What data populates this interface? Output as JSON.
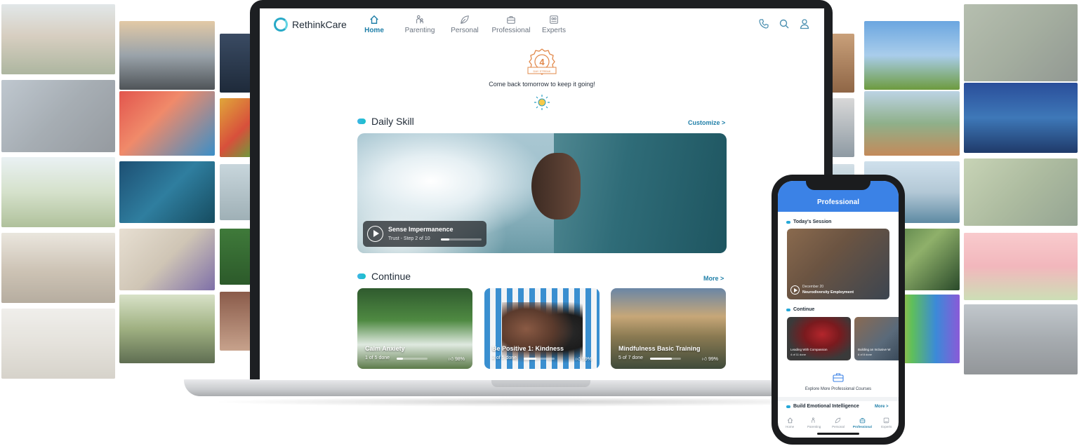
{
  "app": {
    "logo_text": "RethinkCare",
    "accent": "#1f7fa8",
    "phone_header_color": "#3b82e6"
  },
  "nav": {
    "items": [
      {
        "label": "Home",
        "icon": "home-icon",
        "active": true
      },
      {
        "label": "Parenting",
        "icon": "parenting-icon",
        "active": false
      },
      {
        "label": "Personal",
        "icon": "leaf-icon",
        "active": false
      },
      {
        "label": "Professional",
        "icon": "briefcase-icon",
        "active": false
      },
      {
        "label": "Experts",
        "icon": "experts-icon",
        "active": false
      }
    ],
    "right_icons": [
      "phone-icon",
      "search-icon",
      "user-icon"
    ]
  },
  "streak": {
    "count": "4",
    "badge_caption": "DAY STREAK",
    "message": "Come back tomorrow to keep it going!"
  },
  "daily_skill": {
    "heading": "Daily Skill",
    "link": "Customize >",
    "card_title": "Sense Impermanence",
    "card_sub": "Trust - Step 2 of 10",
    "progress": 0.2
  },
  "continue": {
    "heading": "Continue",
    "link": "More >",
    "cards": [
      {
        "title": "Calm Anxiety",
        "done": "1 of 5 done",
        "progress": 0.2,
        "likes": "98%"
      },
      {
        "title": "Be Positive 1: Kindness",
        "done": "2 of 5 done",
        "progress": 0.4,
        "likes": "99%"
      },
      {
        "title": "Mindfulness Basic Training",
        "done": "5 of 7 done",
        "progress": 0.71,
        "likes": "99%"
      }
    ]
  },
  "phone": {
    "header": "Professional",
    "todays_session": "Today's Session",
    "session_date": "December 20",
    "session_title": "Neurodiversity Employment",
    "continue_heading": "Continue",
    "continue_cards": [
      {
        "title": "Leading With Compassion",
        "done": "4 of 11 done"
      },
      {
        "title": "Building an Inclusive W",
        "done": "6 of 8 done"
      }
    ],
    "explore": "Explore More Professional Courses",
    "build_heading": "Build Emotional Intelligence",
    "build_link": "More >",
    "tabs": [
      {
        "label": "Home",
        "icon": "home-icon",
        "active": false
      },
      {
        "label": "Parenting",
        "icon": "parenting-icon",
        "active": false
      },
      {
        "label": "Personal",
        "icon": "leaf-icon",
        "active": false
      },
      {
        "label": "Professional",
        "icon": "briefcase-icon",
        "active": true
      },
      {
        "label": "Experts",
        "icon": "experts-icon",
        "active": false
      }
    ]
  }
}
